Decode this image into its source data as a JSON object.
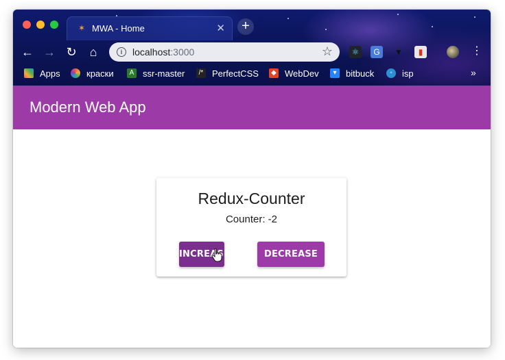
{
  "browser": {
    "tab": {
      "favicon": "app-favicon-icon",
      "title": "MWA - Home"
    },
    "omnibox": {
      "host": "localhost",
      "port": ":3000"
    },
    "bookmarks": [
      {
        "label": "Apps",
        "icon": "apps-grid-icon",
        "color": "#e85d4a"
      },
      {
        "label": "краски",
        "icon": "color-wheel-icon",
        "color": "#f2a93b"
      },
      {
        "label": "ssr-master",
        "icon": "terminal-icon",
        "color": "#2a7a2a"
      },
      {
        "label": "PerfectCSS",
        "icon": "code-icon",
        "color": "#222222"
      },
      {
        "label": "WebDev",
        "icon": "gitlab-icon",
        "color": "#e24329"
      },
      {
        "label": "bitbuck",
        "icon": "bitbucket-icon",
        "color": "#2684ff"
      },
      {
        "label": "isp",
        "icon": "globe-icon",
        "color": "#2b8fd6"
      }
    ]
  },
  "app": {
    "title": "Modern Web App",
    "brand_color": "#9c3ba8",
    "card": {
      "title": "Redux-Counter",
      "counter_label": "Counter: -2",
      "increase_label": "INCREASE",
      "decrease_label": "DECREASE"
    }
  }
}
